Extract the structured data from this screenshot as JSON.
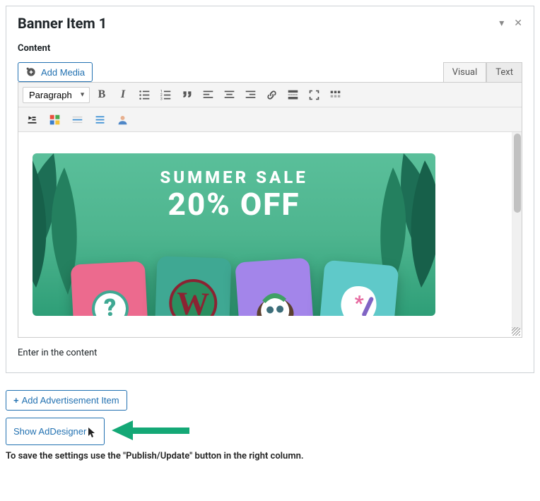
{
  "panel": {
    "title": "Banner Item 1",
    "content_label": "Content"
  },
  "editor": {
    "add_media": "Add Media",
    "tabs": {
      "visual": "Visual",
      "text": "Text"
    },
    "paragraph_select": "Paragraph",
    "banner": {
      "line1": "SUMMER SALE",
      "line2": "20% OFF"
    },
    "helper": "Enter in the content"
  },
  "buttons": {
    "add_item": "Add Advertisement Item",
    "show_addesigner": "Show AdDesigner"
  },
  "footer_note": "To save the settings use the \"Publish/Update\" button in the right column.",
  "toolbar_icons": [
    "bold",
    "italic",
    "ul",
    "ol",
    "quote",
    "align-left",
    "align-center",
    "align-right",
    "link",
    "readmore",
    "fullscreen",
    "toggle"
  ],
  "toolbar_row2_icons": [
    "toggle-toolbar",
    "color-grid",
    "minus-line",
    "indent-lines",
    "user"
  ]
}
